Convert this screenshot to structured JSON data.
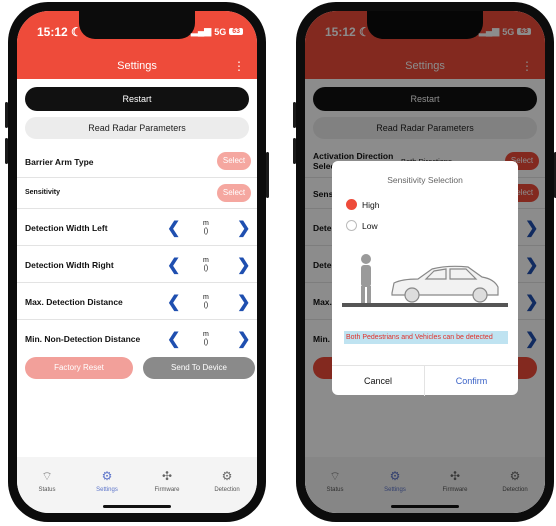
{
  "phone1": {
    "status": {
      "time": "15:12",
      "network": "5G",
      "battery": "63"
    },
    "header": {
      "title": "Settings",
      "menu_icon": "kebab-icon"
    },
    "restart_label": "Restart",
    "read_radar_label": "Read Radar Parameters",
    "rows": [
      {
        "label": "Barrier Arm Type",
        "button": "Select"
      },
      {
        "label": "Sensitivity",
        "button": "Select"
      },
      {
        "label": "Detection Width Left",
        "unit": "m",
        "unit_value": "()"
      },
      {
        "label": "Detection Width Right",
        "unit": "m",
        "unit_value": "()"
      },
      {
        "label": "Max. Detection Distance",
        "unit": "m",
        "unit_value": "()"
      },
      {
        "label": "Min. Non-Detection Distance",
        "unit": "m",
        "unit_value": "()"
      }
    ],
    "factory_reset_label": "Factory Reset",
    "send_label": "Send To Device",
    "tabs": [
      {
        "label": "Status",
        "icon": "wifi-icon"
      },
      {
        "label": "Settings",
        "icon": "settings-icon",
        "active": true
      },
      {
        "label": "Firmware",
        "icon": "chip-icon"
      },
      {
        "label": "Detection",
        "icon": "gear-icon"
      }
    ]
  },
  "phone2": {
    "status": {
      "time": "15:12",
      "network": "5G",
      "battery": "63"
    },
    "header": {
      "title": "Settings"
    },
    "restart_label": "Restart",
    "read_radar_label": "Read Radar Parameters",
    "activation_label": "Activation Direction Selection",
    "activation_value": "Both Directions",
    "select_label": "Select",
    "bg_rows": [
      "Sens",
      "Dete",
      "Dete",
      "Max.",
      "Min."
    ],
    "dialog": {
      "title": "Sensitivity Selection",
      "options": [
        {
          "label": "High",
          "selected": true
        },
        {
          "label": "Low",
          "selected": false
        }
      ],
      "note": "Both Pedestrians and Vehicles can be detected",
      "cancel": "Cancel",
      "confirm": "Confirm"
    },
    "tabs": [
      {
        "label": "Status",
        "icon": "wifi-icon"
      },
      {
        "label": "Settings",
        "icon": "settings-icon",
        "active": true
      },
      {
        "label": "Firmware",
        "icon": "chip-icon"
      },
      {
        "label": "Detection",
        "icon": "gear-icon"
      }
    ]
  }
}
